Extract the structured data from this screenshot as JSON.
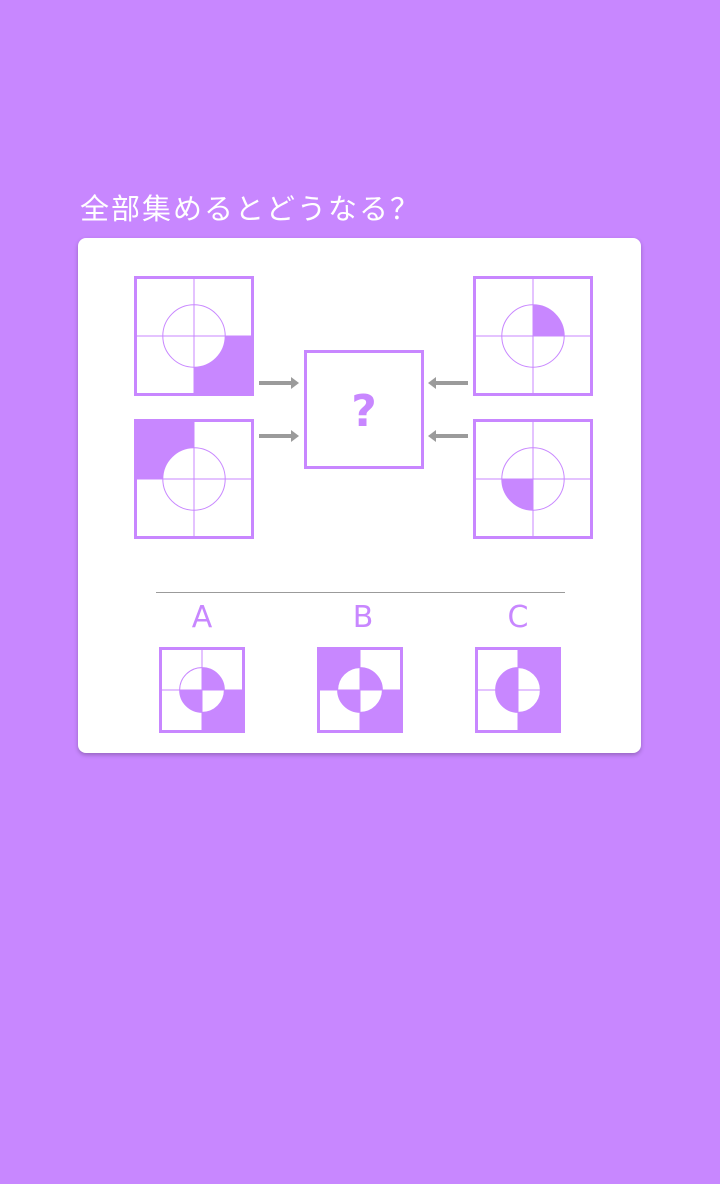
{
  "question": {
    "title": "全部集めるとどうなる？",
    "result_symbol": "?"
  },
  "colors": {
    "background": "#c887ff",
    "accent": "#c887ff",
    "card": "#ffffff",
    "arrow": "#9b9b9b"
  },
  "puzzle": {
    "inputs": [
      {
        "id": "top-left",
        "filled_corner": "bottom-right",
        "filled_circle_quadrant": null
      },
      {
        "id": "bottom-left",
        "filled_corner": "top-left",
        "filled_circle_quadrant": null
      },
      {
        "id": "top-right",
        "filled_corner": null,
        "filled_circle_quadrant": "top-right"
      },
      {
        "id": "bottom-right",
        "filled_corner": null,
        "filled_circle_quadrant": "bottom-left"
      }
    ]
  },
  "options": [
    {
      "label": "A",
      "filled_corners": [
        "bottom-right"
      ],
      "filled_circle_quadrants": [
        "top-right",
        "bottom-left"
      ]
    },
    {
      "label": "B",
      "filled_corners": [
        "top-left",
        "bottom-right"
      ],
      "filled_circle_quadrants": [
        "top-right",
        "bottom-left"
      ]
    },
    {
      "label": "C",
      "filled_corners": [
        "top-right",
        "bottom-right"
      ],
      "filled_circle_quadrants": [
        "top-left",
        "bottom-left"
      ]
    }
  ]
}
